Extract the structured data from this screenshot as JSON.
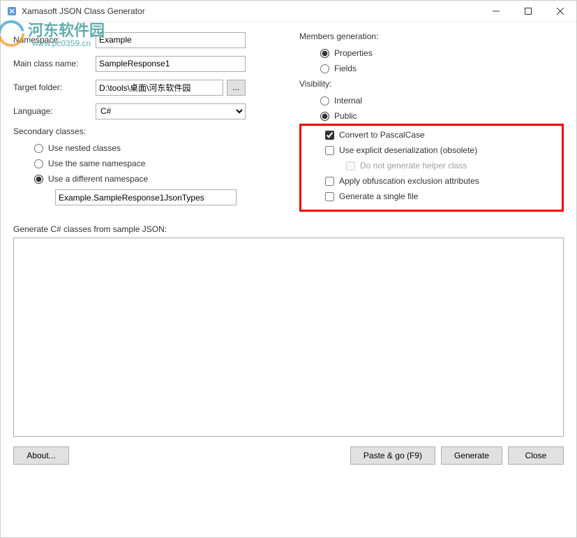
{
  "window": {
    "title": "Xamasoft JSON Class Generator"
  },
  "watermark": {
    "text": "河东软件园",
    "url": "www.pc0359.cn"
  },
  "labels": {
    "namespace": "Namespace:",
    "mainclass": "Main class name:",
    "target": "Target folder:",
    "language": "Language:",
    "secondary": "Secondary classes:",
    "members": "Members generation:",
    "visibility": "Visibility:",
    "genprompt": "Generate C# classes from sample JSON:",
    "browse": "..."
  },
  "values": {
    "namespace": "Example",
    "mainclass": "SampleResponse1",
    "target": "D:\\tools\\桌面\\河东软件园",
    "language": "C#",
    "diffns": "Example.SampleResponse1JsonTypes"
  },
  "secondary": {
    "nested": "Use nested classes",
    "same": "Use the same namespace",
    "diff": "Use a different namespace"
  },
  "members": {
    "properties": "Properties",
    "fields": "Fields"
  },
  "visibility": {
    "internal": "Internal",
    "public": "Public"
  },
  "opts": {
    "pascal": "Convert to PascalCase",
    "explicit": "Use explicit deserialization (obsolete)",
    "nohelper": "Do not generate helper class",
    "obfus": "Apply obfuscation exclusion attributes",
    "single": "Generate a single file"
  },
  "buttons": {
    "about": "About...",
    "paste": "Paste & go (F9)",
    "generate": "Generate",
    "close": "Close"
  }
}
